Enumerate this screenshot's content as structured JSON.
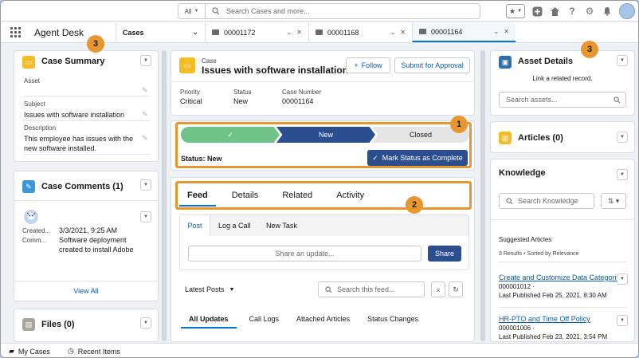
{
  "header": {
    "search_scope": "All",
    "search_placeholder": "Search Cases and more..."
  },
  "nav": {
    "app_name": "Agent Desk",
    "object_tab": "Cases",
    "workspace_tabs": [
      "00001172",
      "00001168",
      "00001164"
    ],
    "active_tab_index": 2
  },
  "case_summary": {
    "title": "Case Summary",
    "fields": [
      {
        "label": "Asset",
        "value": ""
      },
      {
        "label": "Subject",
        "value": "Issues with software installation"
      },
      {
        "label": "Description",
        "value": "This employee has issues with the new software installed."
      }
    ]
  },
  "case_comments": {
    "title": "Case Comments (1)",
    "created_label": "Created...",
    "comment_label": "Comm...",
    "created_value": "3/3/2021, 9:25 AM",
    "comment_value": "Software deployment created to install Adobe",
    "view_all": "View All"
  },
  "files": {
    "title": "Files (0)"
  },
  "case_record": {
    "object_label": "Case",
    "title": "Issues with software installation",
    "follow_label": "Follow",
    "submit_label": "Submit for Approval",
    "highlights": [
      {
        "label": "Priority",
        "value": "Critical"
      },
      {
        "label": "Status",
        "value": "New"
      },
      {
        "label": "Case Number",
        "value": "00001164"
      }
    ]
  },
  "path": {
    "steps": [
      "✓",
      "New",
      "Closed"
    ],
    "current_step": 1,
    "status_text": "Status: New",
    "mark_complete_label": "Mark Status as Complete"
  },
  "record_tabs": {
    "tabs": [
      "Feed",
      "Details",
      "Related",
      "Activity"
    ],
    "active": 0
  },
  "publisher": {
    "tabs": [
      "Post",
      "Log a Call",
      "New Task"
    ],
    "active": 0,
    "placeholder": "Share an update...",
    "share_label": "Share"
  },
  "feed": {
    "sort_label": "Latest Posts",
    "search_placeholder": "Search this feed...",
    "filters": [
      "All Updates",
      "Call Logs",
      "Attached Articles",
      "Status Changes"
    ],
    "active_filter": 0
  },
  "asset_details": {
    "title": "Asset Details",
    "link_text": "Link a related record.",
    "search_placeholder": "Search assets..."
  },
  "articles": {
    "title": "Articles (0)"
  },
  "knowledge": {
    "title": "Knowledge",
    "search_placeholder": "Search Knowledge",
    "suggested_label": "Suggested Articles",
    "results_text": "3 Results • Sorted by Relevance",
    "articles": [
      {
        "title": "Create and Customize Data Categories",
        "number": "000001012",
        "published_label": "Last Published",
        "published": "Feb 25, 2021, 8:30 AM"
      },
      {
        "title": "HR-PTO and Time Off Policy",
        "number": "000001006",
        "published_label": "Last Published",
        "published": "Feb 23, 2021, 3:54 PM"
      }
    ]
  },
  "callouts": [
    "1",
    "2",
    "3",
    "3"
  ],
  "utility_bar": {
    "items": [
      "My Cases",
      "Recent Items"
    ]
  },
  "colors": {
    "path_complete": "#6dc486",
    "path_current": "#2b4e8f",
    "path_future": "#e5e5e5",
    "callout": "#e8962f",
    "brand": "#0176d3"
  }
}
